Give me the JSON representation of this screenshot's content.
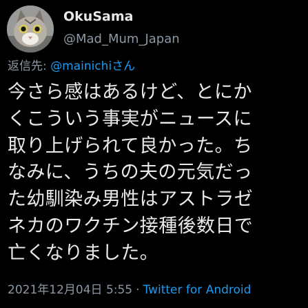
{
  "user": {
    "display_name": "OkuSama",
    "handle": "@Mad_Mum_Japan",
    "avatar_icon": "cat-avatar-icon"
  },
  "reply": {
    "prefix": "返信先: ",
    "mention": "@mainichiさん"
  },
  "tweet": {
    "lines": [
      "今さら感はあるけど、とにか",
      "くこういう事実がニュースに",
      "取り上げられて良かった。ち",
      "なみに、うちの夫の元気だっ",
      "た幼馴染み男性はアストラゼ",
      "ネカのワクチン接種後数日で",
      "亡くなりました。"
    ]
  },
  "meta": {
    "date": "2021年12月04日",
    "time": "5:55",
    "separator": "·",
    "source": "Twitter for Android"
  },
  "colors": {
    "background": "#000000",
    "text": "#e7e9ea",
    "secondary": "#8b98a5",
    "link": "#1d9bf0"
  }
}
